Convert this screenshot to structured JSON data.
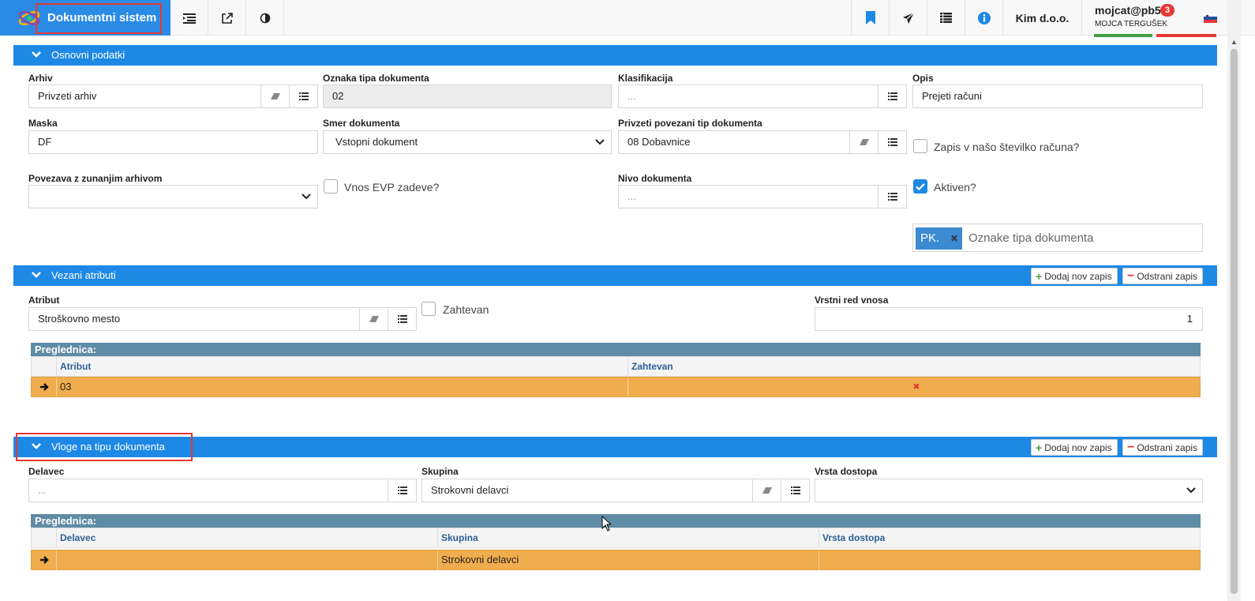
{
  "app": {
    "title": "Dokumentni sistem",
    "company": "Kim d.o.o.",
    "user": "mojcat@pb5",
    "user_full_name": "MOJCA TERGUŠEK",
    "notification_count": "3",
    "language_flag": "slovenia-flag-icon",
    "toolbar_icons": [
      "list-indent-icon",
      "external-link-icon",
      "contrast-icon"
    ],
    "right_icons": [
      "bookmark-icon",
      "send-icon",
      "list-icon",
      "info-icon"
    ]
  },
  "colors": {
    "primary": "#1e88e5",
    "grid_header": "#5e8ba5",
    "row_selected": "#f0ad4e",
    "danger": "#e53935",
    "success": "#43a047"
  },
  "osnovni": {
    "title": "Osnovni podatki",
    "arhiv_label": "Arhiv",
    "arhiv_value": "Privzeti arhiv",
    "oznaka_label": "Oznaka tipa dokumenta",
    "oznaka_value": "02",
    "klasifikacija_label": "Klasifikacija",
    "klasifikacija_placeholder": "...",
    "opis_label": "Opis",
    "opis_value": "Prejeti računi",
    "maska_label": "Maska",
    "maska_value": "DF",
    "smer_label": "Smer dokumenta",
    "smer_value": "Vstopni dokument",
    "povezani_label": "Privzeti povezani tip dokumenta",
    "povezani_value": "08 Dobavnice",
    "zapis_label": "Zapis v našo številko računa?",
    "zapis_checked": false,
    "povezava_label": "Povezava z zunanjim arhivom",
    "povezava_value": "",
    "evp_label": "Vnos EVP zadeve?",
    "evp_checked": false,
    "nivo_label": "Nivo dokumenta",
    "nivo_placeholder": "...",
    "aktiven_label": "Aktiven?",
    "aktiven_checked": true,
    "tag_value": "PK.",
    "tag_placeholder": "Oznake tipa dokumenta"
  },
  "vezani": {
    "title": "Vezani atributi",
    "add_label": "Dodaj nov zapis",
    "remove_label": "Odstrani zapis",
    "atribut_label": "Atribut",
    "atribut_value": "Stroškovno mesto",
    "zahtevan_label": "Zahtevan",
    "zahtevan_checked": false,
    "vrstni_label": "Vrstni red vnosa",
    "vrstni_value": "1",
    "grid_title": "Preglednica:",
    "columns": [
      "Atribut",
      "Zahtevan"
    ],
    "rows": [
      {
        "atribut": "03",
        "zahtevan": "✖"
      }
    ]
  },
  "vloge": {
    "title": "Vloge na tipu dokumenta",
    "add_label": "Dodaj nov zapis",
    "remove_label": "Odstrani zapis",
    "delavec_label": "Delavec",
    "delavec_placeholder": "...",
    "skupina_label": "Skupina",
    "skupina_value": "Strokovni delavci",
    "dostop_label": "Vrsta dostopa",
    "dostop_value": "",
    "grid_title": "Preglednica:",
    "columns": [
      "Delavec",
      "Skupina",
      "Vrsta dostopa"
    ],
    "rows": [
      {
        "delavec": "",
        "skupina": "Strokovni delavci",
        "dostop": ""
      }
    ]
  }
}
